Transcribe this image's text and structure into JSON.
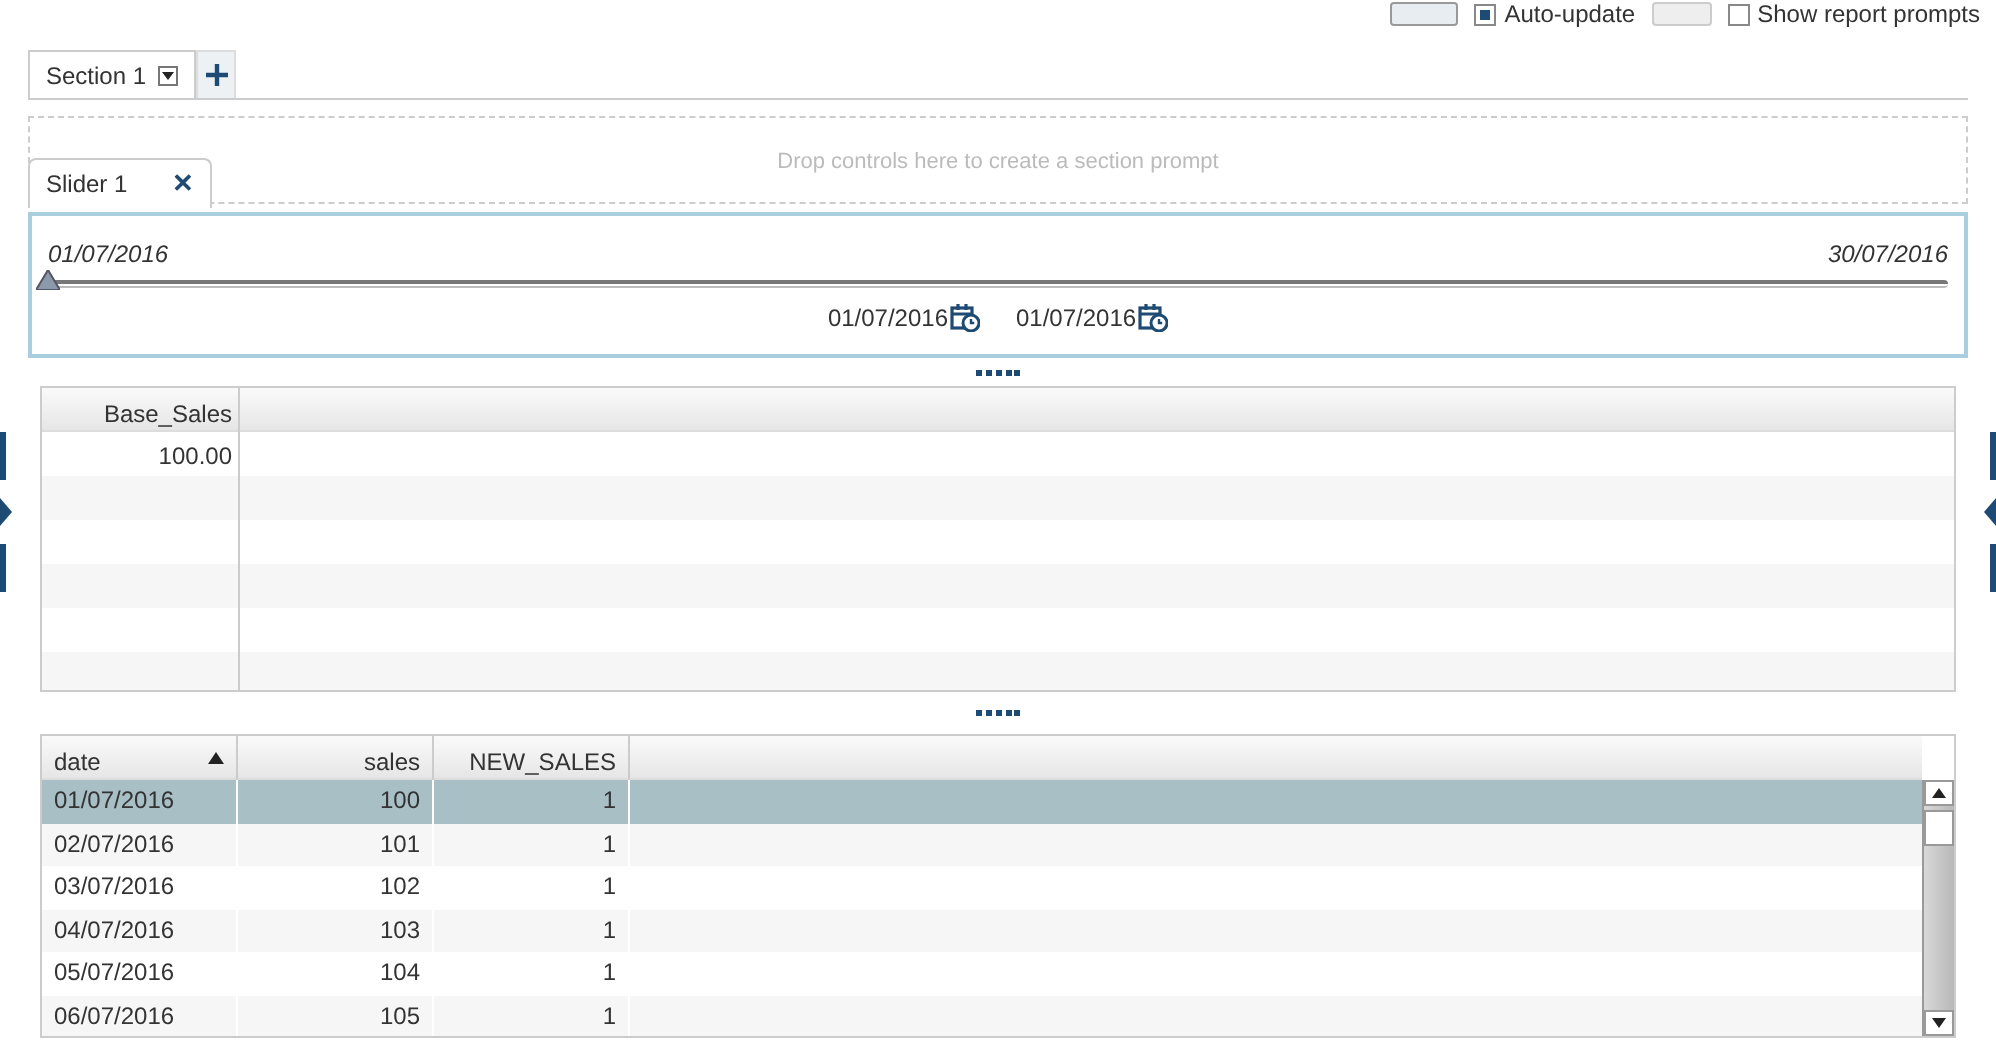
{
  "toolbar": {
    "auto_update": {
      "label": "Auto-update",
      "checked": true
    },
    "show_report_prompts": {
      "label": "Show report prompts",
      "checked": false
    }
  },
  "section_tabs": [
    {
      "label": "Section 1",
      "selected": true
    }
  ],
  "drop_zone": {
    "text": "Drop controls here to create a section prompt"
  },
  "slider_tab": {
    "label": "Slider 1",
    "close": "✕"
  },
  "slider": {
    "min": "01/07/2016",
    "max": "30/07/2016",
    "level": 0,
    "from": "01/07/2016",
    "to": "01/07/2016"
  },
  "summary_table": {
    "columns": [
      "Base_Sales"
    ],
    "rows": [
      [
        "100.00"
      ]
    ]
  },
  "detail_table": {
    "columns": [
      {
        "label": "date",
        "sorted_ascending": true
      },
      {
        "label": "sales"
      },
      {
        "label": "NEW_SALES"
      }
    ],
    "rows": [
      {
        "cells": [
          "01/07/2016",
          "100",
          "1"
        ],
        "selected": true
      },
      {
        "cells": [
          "02/07/2016",
          "101",
          "1"
        ],
        "selected": false
      },
      {
        "cells": [
          "03/07/2016",
          "102",
          "1"
        ],
        "selected": false
      },
      {
        "cells": [
          "04/07/2016",
          "103",
          "1"
        ],
        "selected": false
      },
      {
        "cells": [
          "05/07/2016",
          "104",
          "1"
        ],
        "selected": false
      },
      {
        "cells": [
          "06/07/2016",
          "105",
          "1"
        ],
        "selected": false
      }
    ]
  }
}
